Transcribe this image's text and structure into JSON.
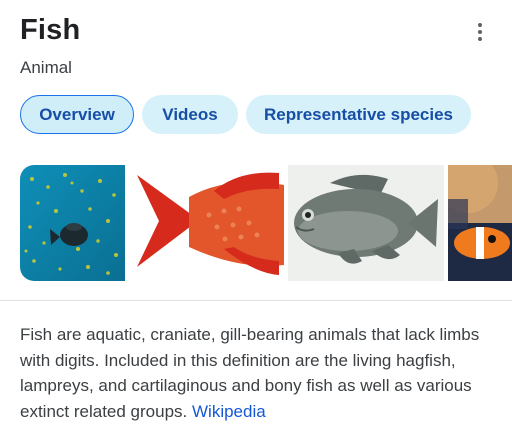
{
  "header": {
    "title": "Fish",
    "subtitle": "Animal",
    "more_icon": "more-vert-icon"
  },
  "chips": [
    {
      "label": "Overview",
      "active": true
    },
    {
      "label": "Videos",
      "active": false
    },
    {
      "label": "Representative species",
      "active": false
    }
  ],
  "images": [
    {
      "subject": "fish-underwater-school"
    },
    {
      "subject": "red-fish"
    },
    {
      "subject": "gray-fish"
    },
    {
      "subject": "clownfish-partial"
    }
  ],
  "description": {
    "text": "Fish are aquatic, craniate, gill-bearing animals that lack limbs with digits. Included in this definition are the living hagfish, lampreys, and cartilaginous and bony fish as well as various extinct related groups.",
    "source_link": "Wikipedia"
  },
  "colors": {
    "chip_bg": "#d6f1fa",
    "chip_text": "#174ea6",
    "active_border": "#1a73e8",
    "link": "#1558d6"
  }
}
